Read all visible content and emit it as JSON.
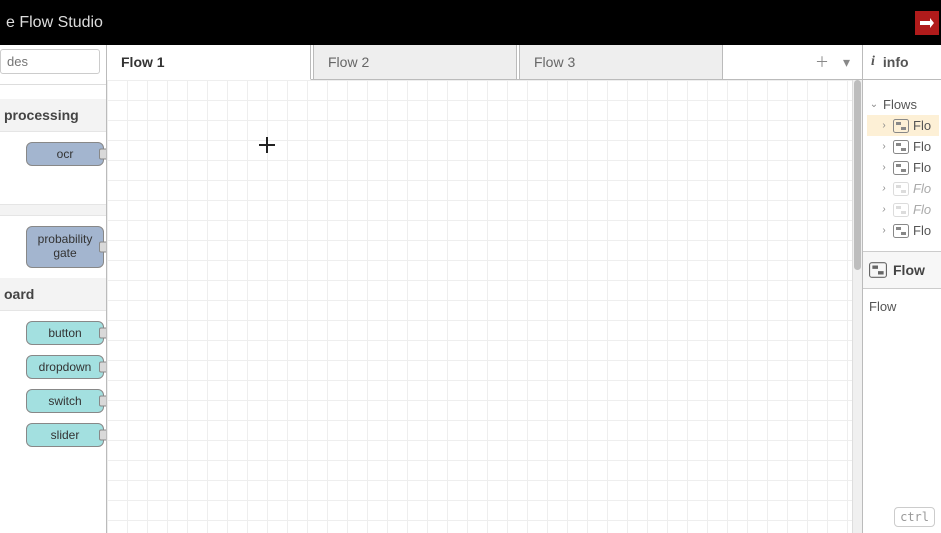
{
  "header": {
    "title": "e Flow Studio"
  },
  "sidebar": {
    "search_placeholder": "des",
    "categories": {
      "processing": {
        "title": "processing",
        "ocr": "ocr",
        "prob_gate": "probability gate"
      },
      "board": {
        "title": "oard",
        "button": "button",
        "dropdown": "dropdown",
        "switch": "switch",
        "slider": "slider"
      }
    }
  },
  "tabs": {
    "t1": "Flow 1",
    "t2": "Flow 2",
    "t3": "Flow 3"
  },
  "info": {
    "title": "info",
    "flows_group": "Flows",
    "flow_label": "Flo",
    "section": "Flow",
    "body": "Flow",
    "kbd": "ctrl"
  }
}
